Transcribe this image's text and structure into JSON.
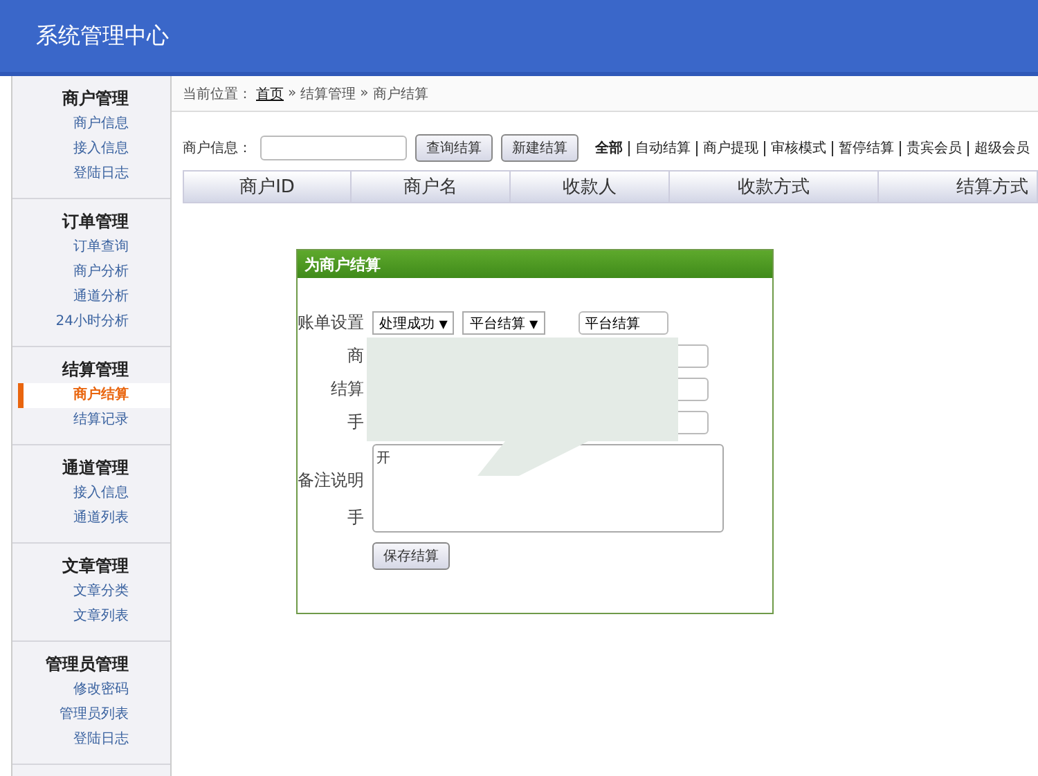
{
  "header": {
    "title": "系统管理中心"
  },
  "sidebar": {
    "groups": [
      {
        "title": "商户管理",
        "items": [
          {
            "label": "商户信息",
            "selected": false
          },
          {
            "label": "接入信息",
            "selected": false
          },
          {
            "label": "登陆日志",
            "selected": false
          }
        ]
      },
      {
        "title": "订单管理",
        "items": [
          {
            "label": "订单查询",
            "selected": false
          },
          {
            "label": "商户分析",
            "selected": false
          },
          {
            "label": "通道分析",
            "selected": false
          },
          {
            "label": "24小时分析",
            "selected": false
          }
        ]
      },
      {
        "title": "结算管理",
        "items": [
          {
            "label": "商户结算",
            "selected": true
          },
          {
            "label": "结算记录",
            "selected": false
          }
        ]
      },
      {
        "title": "通道管理",
        "items": [
          {
            "label": "接入信息",
            "selected": false
          },
          {
            "label": "通道列表",
            "selected": false
          }
        ]
      },
      {
        "title": "文章管理",
        "items": [
          {
            "label": "文章分类",
            "selected": false
          },
          {
            "label": "文章列表",
            "selected": false
          }
        ]
      },
      {
        "title": "管理员管理",
        "items": [
          {
            "label": "修改密码",
            "selected": false
          },
          {
            "label": "管理员列表",
            "selected": false
          },
          {
            "label": "登陆日志",
            "selected": false
          }
        ]
      }
    ]
  },
  "breadcrumb": {
    "prefix": "当前位置：",
    "links": [
      "首页",
      "结算管理",
      "商户结算"
    ],
    "separator": "»"
  },
  "search": {
    "label": "商户信息：",
    "buttons": [
      "查询结算",
      "新建结算"
    ]
  },
  "filters": [
    {
      "label": "全部",
      "selected": true
    },
    {
      "label": "自动结算",
      "selected": false
    },
    {
      "label": "商户提现",
      "selected": false
    },
    {
      "label": "审核模式",
      "selected": false
    },
    {
      "label": "暂停结算",
      "selected": false
    },
    {
      "label": "贵宾会员",
      "selected": false
    },
    {
      "label": "超级会员",
      "selected": false
    }
  ],
  "table": {
    "columns": [
      "商户ID",
      "商户名",
      "收款人",
      "收款方式",
      "结算方式"
    ]
  },
  "dialog": {
    "title": "为商户结算",
    "labels": [
      "账单设置",
      "商",
      "结算",
      "手",
      "备注说明",
      "手"
    ],
    "selects": [
      "处理成功",
      "平台结算"
    ],
    "select_arrow": "▼",
    "field_value": "平台结算",
    "note_text": "开",
    "save_button": "保存结算"
  }
}
